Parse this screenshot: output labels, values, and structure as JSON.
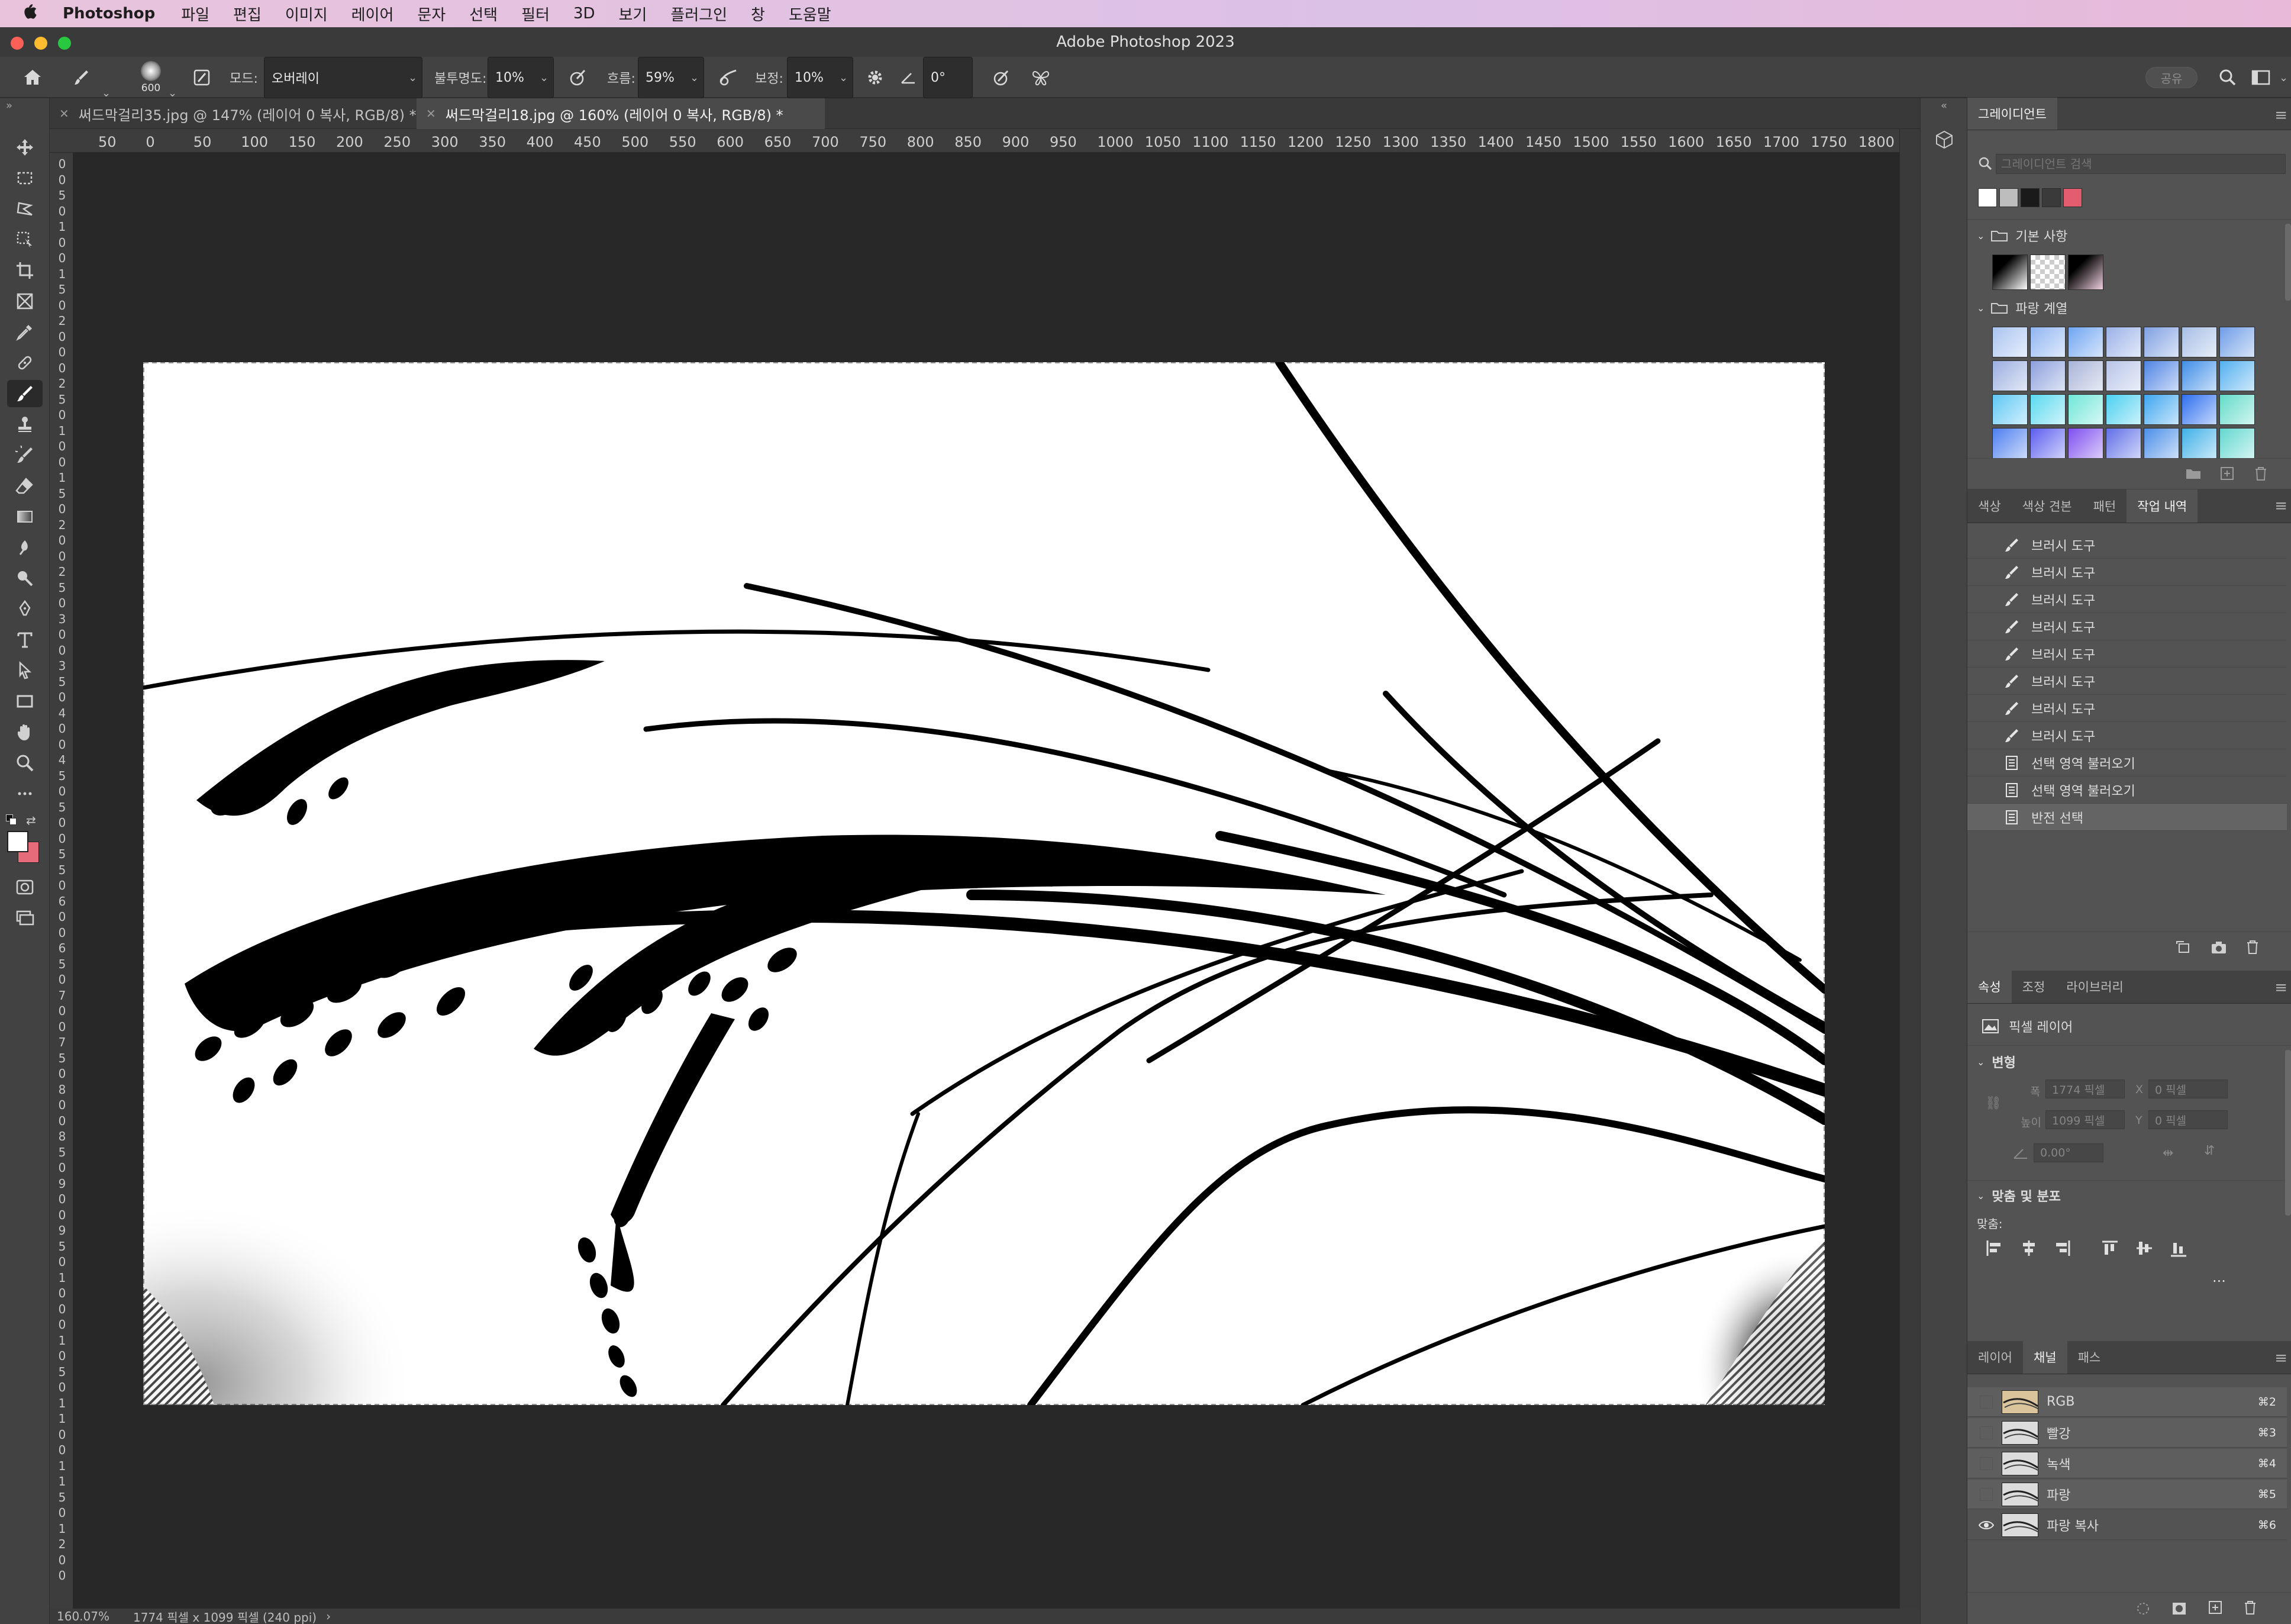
{
  "menubar": {
    "apple_icon": "apple-logo",
    "app_name": "Photoshop",
    "items": [
      "파일",
      "편집",
      "이미지",
      "레이어",
      "문자",
      "선택",
      "필터",
      "3D",
      "보기",
      "플러그인",
      "창",
      "도움말"
    ]
  },
  "window": {
    "title": "Adobe Photoshop 2023"
  },
  "options": {
    "brush_size": "600",
    "mode_label": "모드:",
    "mode_value": "오버레이",
    "opacity_label": "불투명도:",
    "opacity_value": "10%",
    "flow_label": "흐름:",
    "flow_value": "59%",
    "smoothing_label": "보정:",
    "smoothing_value": "10%",
    "angle_value": "0°",
    "share_label": "공유"
  },
  "tabs": [
    {
      "title": "써드막걸리35.jpg @ 147% (레이어 0 복사, RGB/8) *",
      "active": false
    },
    {
      "title": "써드막걸리18.jpg @ 160% (레이어 0 복사, RGB/8) *",
      "active": true
    }
  ],
  "ruler": {
    "top": [
      "50",
      "0",
      "50",
      "100",
      "150",
      "200",
      "250",
      "300",
      "350",
      "400",
      "450",
      "500",
      "550",
      "600",
      "650",
      "700",
      "750",
      "800",
      "850",
      "900",
      "950",
      "1000",
      "1050",
      "1100",
      "1150",
      "1200",
      "1250",
      "1300",
      "1350",
      "1400",
      "1450",
      "1500",
      "1550",
      "1600",
      "1650",
      "1700",
      "1750",
      "1800"
    ],
    "left": [
      "0",
      "0",
      "5",
      "0",
      "1",
      "0",
      "0",
      "1",
      "5",
      "0",
      "2",
      "0",
      "0",
      "0",
      "2",
      "5",
      "0",
      "1",
      "0",
      "0",
      "1",
      "5",
      "0",
      "2",
      "0",
      "0",
      "2",
      "5",
      "0",
      "3",
      "0",
      "0",
      "3",
      "5",
      "0",
      "4",
      "0",
      "0",
      "4",
      "5",
      "0",
      "5",
      "0",
      "0",
      "5",
      "5",
      "0",
      "6",
      "0",
      "0",
      "6",
      "5",
      "0",
      "7",
      "0",
      "0",
      "7",
      "5",
      "0",
      "8",
      "0",
      "0",
      "8",
      "5",
      "0",
      "9",
      "0",
      "0",
      "9",
      "5",
      "0",
      "1",
      "0",
      "0",
      "0",
      "1",
      "0",
      "5",
      "0",
      "1",
      "1",
      "0",
      "0",
      "1",
      "1",
      "5",
      "0",
      "1",
      "2",
      "0",
      "0"
    ]
  },
  "status": {
    "zoom": "160.07%",
    "doc_info": "1774 픽셀 x 1099 픽셀 (240 ppi)"
  },
  "gradients": {
    "tab_label": "그레이디언트",
    "search_placeholder": "그레이디언트 검색",
    "group_basic": "기본 사항",
    "group_blue": "파랑 계열",
    "recent_colors": [
      "#ffffff",
      "#bdbdbd",
      "#1a1a1a",
      "#3a3a3a",
      "#e35d6f"
    ],
    "basic_swatches": [
      "black-white",
      "transparent",
      "black-pink"
    ],
    "blue_swatches": [
      "#a9c4f0",
      "#8fb5f2",
      "#6fa5f2",
      "#9ab2e8",
      "#7ea0e2",
      "#a7bfe6",
      "#6f9de8",
      "#9aaee0",
      "#8b9fdc",
      "#a8b4d8",
      "#b8c5e8",
      "#4f84e4",
      "#3f8ee8",
      "#53b0f0",
      "#5ec7f5",
      "#59d9ef",
      "#6fe6d8",
      "#4ad0f0",
      "#3ea6f0",
      "#2f6ff0",
      "#62dcc8",
      "#4d7ef0",
      "#5b5ef0",
      "#7e4ef0",
      "#5f6fe8",
      "#4b8fe8",
      "#3fb0e8",
      "#63d8d0"
    ]
  },
  "history": {
    "tabs": [
      "색상",
      "색상 견본",
      "패턴",
      "작업 내역"
    ],
    "active_tab": "작업 내역",
    "items": [
      {
        "label": "브러시 도구",
        "icon": "brush-icon",
        "selected": false
      },
      {
        "label": "브러시 도구",
        "icon": "brush-icon",
        "selected": false
      },
      {
        "label": "브러시 도구",
        "icon": "brush-icon",
        "selected": false
      },
      {
        "label": "브러시 도구",
        "icon": "brush-icon",
        "selected": false
      },
      {
        "label": "브러시 도구",
        "icon": "brush-icon",
        "selected": false
      },
      {
        "label": "브러시 도구",
        "icon": "brush-icon",
        "selected": false
      },
      {
        "label": "브러시 도구",
        "icon": "brush-icon",
        "selected": false
      },
      {
        "label": "브러시 도구",
        "icon": "brush-icon",
        "selected": false
      },
      {
        "label": "선택 영역 불러오기",
        "icon": "document-icon",
        "selected": false
      },
      {
        "label": "선택 영역 불러오기",
        "icon": "document-icon",
        "selected": false
      },
      {
        "label": "반전 선택",
        "icon": "document-icon",
        "selected": true
      }
    ]
  },
  "properties": {
    "tabs": [
      "속성",
      "조정",
      "라이브러리"
    ],
    "active_tab": "속성",
    "layer_type": "픽셀 레이어",
    "transform_title": "변형",
    "width_label": "폭",
    "width_value": "1774 픽셀",
    "height_label": "높이",
    "height_value": "1099 픽셀",
    "x_label": "X",
    "x_value": "0 픽셀",
    "y_label": "Y",
    "y_value": "0 픽셀",
    "angle_value": "0.00°",
    "align_title": "맞춤 및 분포",
    "align_label": "맞춤:",
    "more_label": "..."
  },
  "channels": {
    "tabs": [
      "레이어",
      "채널",
      "패스"
    ],
    "active_tab": "채널",
    "items": [
      {
        "name": "RGB",
        "shortcut": "⌘2",
        "visible": false
      },
      {
        "name": "빨강",
        "shortcut": "⌘3",
        "visible": false
      },
      {
        "name": "녹색",
        "shortcut": "⌘4",
        "visible": false
      },
      {
        "name": "파랑",
        "shortcut": "⌘5",
        "visible": false
      },
      {
        "name": "파랑 복사",
        "shortcut": "⌘6",
        "visible": true
      }
    ]
  },
  "colors": {
    "foreground": "#ffffff",
    "background": "#e56b78",
    "accent": "#2d8ceb"
  }
}
